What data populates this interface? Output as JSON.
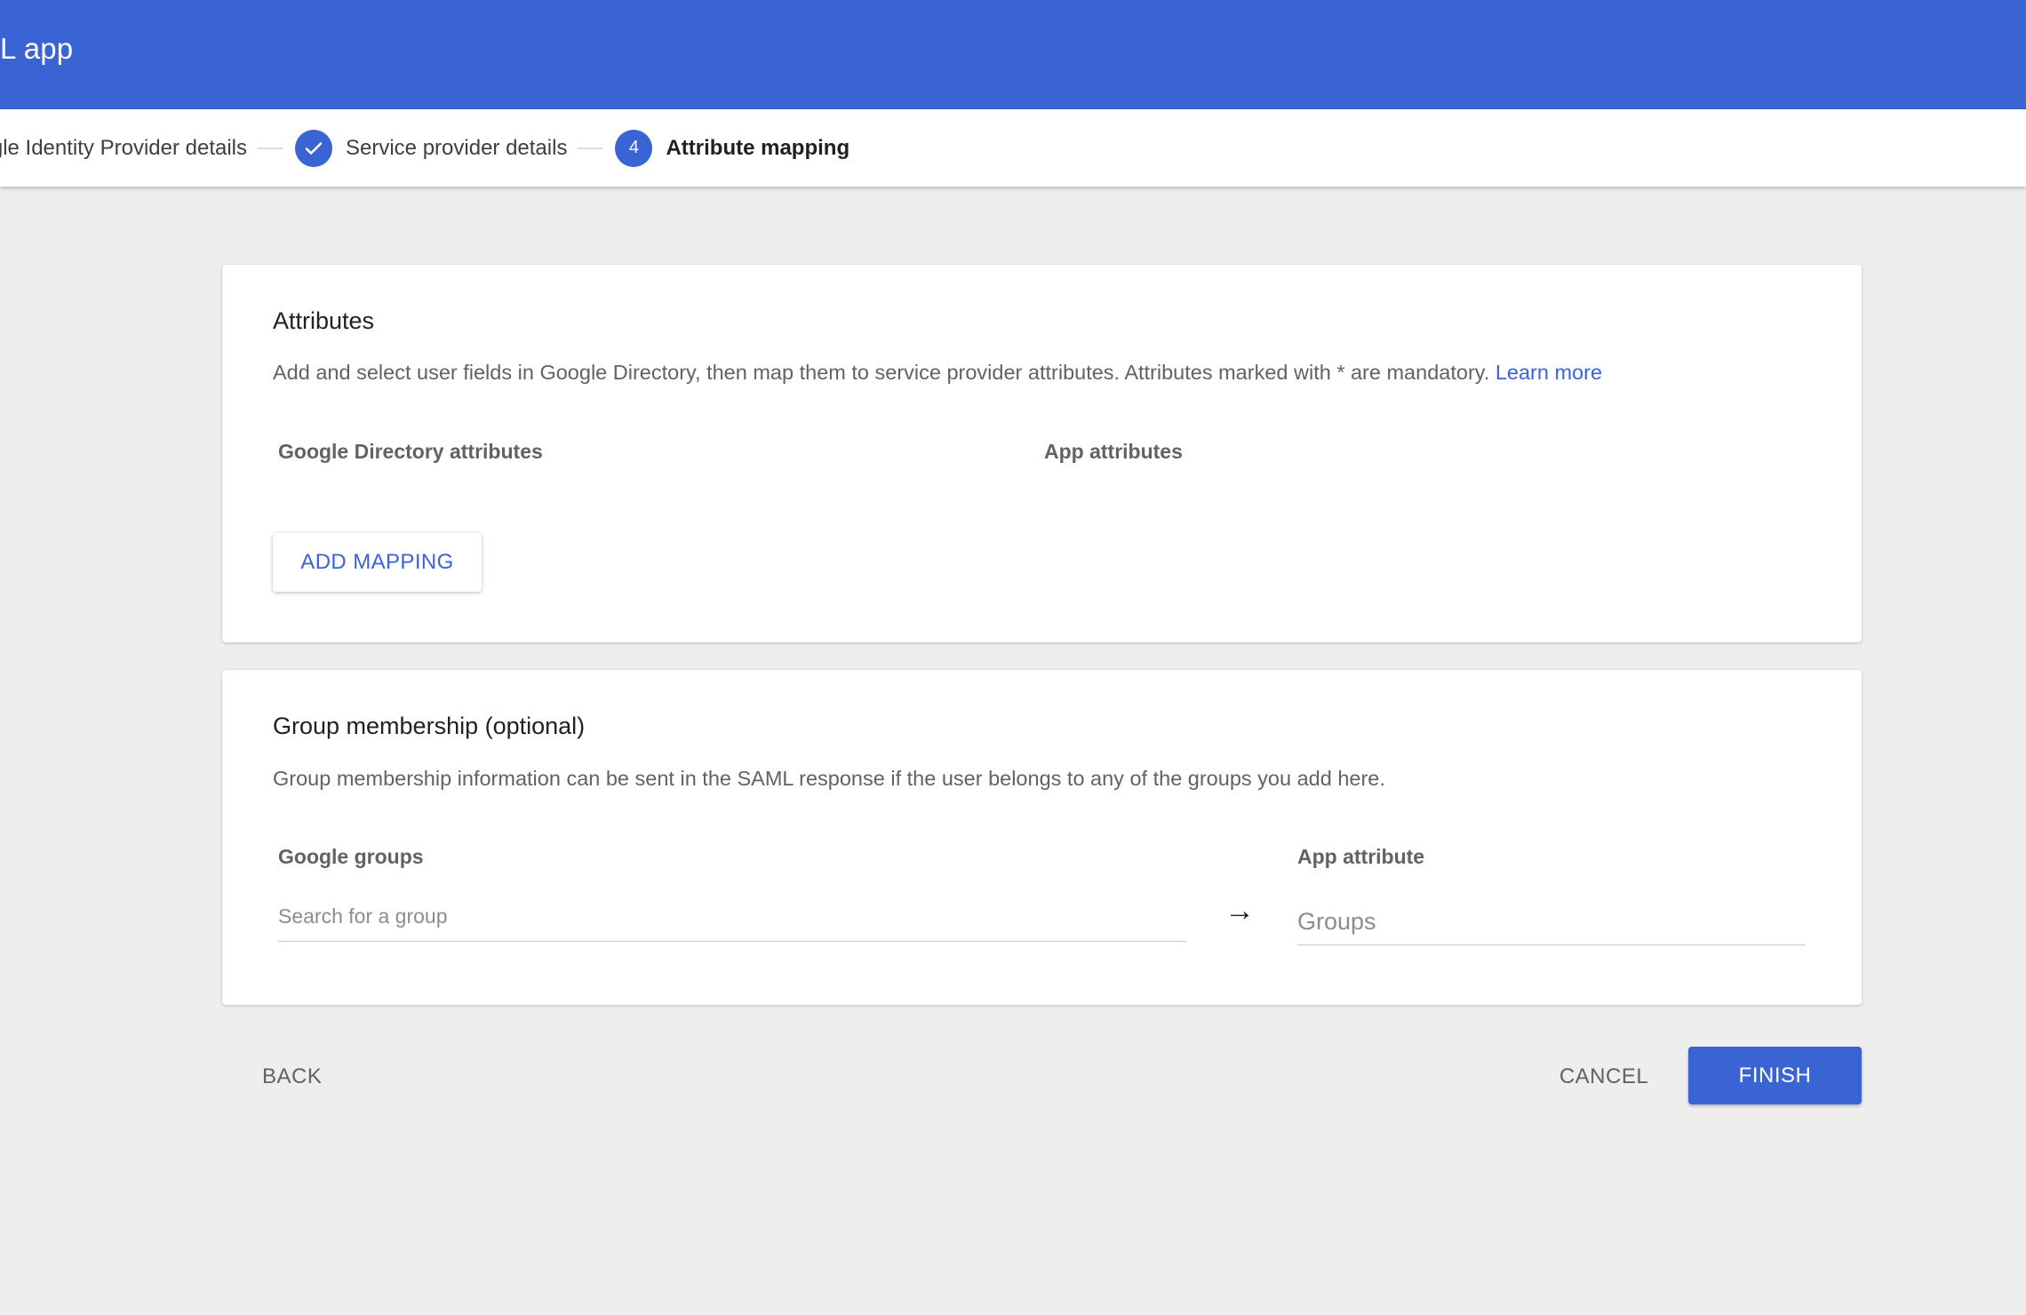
{
  "header": {
    "title": "L app"
  },
  "stepper": {
    "steps": [
      {
        "label": "Google Identity Provider details",
        "state": "done"
      },
      {
        "label": "Service provider details",
        "state": "done"
      },
      {
        "label": "Attribute mapping",
        "state": "active",
        "number": "4"
      }
    ]
  },
  "attributes_card": {
    "title": "Attributes",
    "description": "Add and select user fields in Google Directory, then map them to service provider attributes. Attributes marked with * are mandatory.",
    "learn_more": "Learn more",
    "col_directory": "Google Directory attributes",
    "col_app": "App attributes",
    "add_mapping_label": "ADD MAPPING"
  },
  "group_card": {
    "title": "Group membership (optional)",
    "description": "Group membership information can be sent in the SAML response if the user belongs to any of the groups you add here.",
    "col_groups": "Google groups",
    "col_app_attribute": "App attribute",
    "search_placeholder": "Search for a group",
    "search_value": "",
    "app_attribute_placeholder": "Groups",
    "app_attribute_value": "",
    "arrow_icon": "right-arrow-icon"
  },
  "footer": {
    "back_label": "BACK",
    "cancel_label": "CANCEL",
    "finish_label": "FINISH"
  },
  "colors": {
    "primary": "#3a63d4",
    "background": "#eeeeee"
  }
}
